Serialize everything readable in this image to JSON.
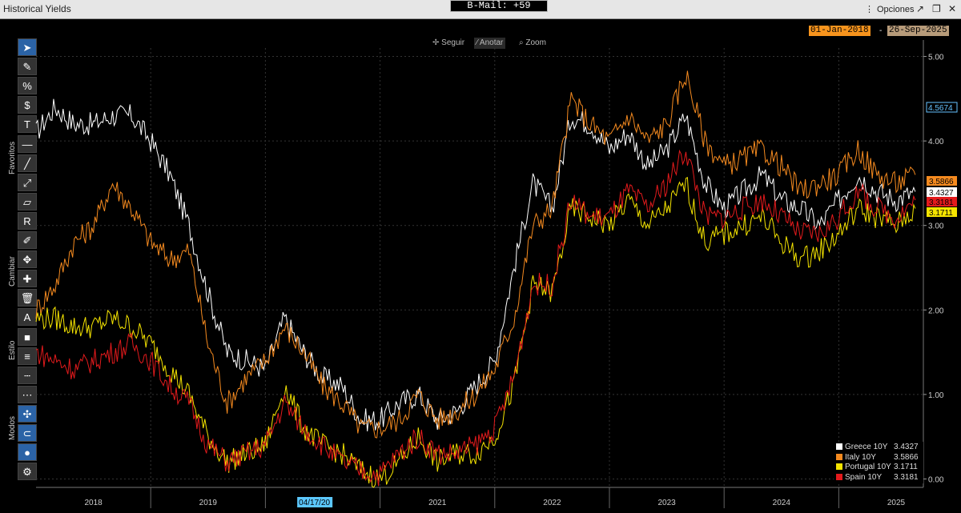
{
  "window": {
    "title": "Historical Yields",
    "bmail": "B-Mail: +59",
    "options_label": "Opciones"
  },
  "controls": {
    "follow": "Seguir",
    "annotate": "Anotar",
    "zoom": "Zoom",
    "start_date": "01-Jan-2018",
    "end_date": "26-Sep-2025",
    "start_color": "#f7941d",
    "end_color": "#b79b7a"
  },
  "toolbar": {
    "sections": [
      "Favoritos",
      "Cambiar",
      "Estilo",
      "Modos"
    ],
    "tools": [
      "cursor-icon",
      "pencil-icon",
      "percent-icon",
      "dollar-icon",
      "text-icon",
      "horizontal-line-icon",
      "trend-line-icon",
      "ray-line-icon",
      "channel-icon",
      "r-icon",
      "brush-icon",
      "move-icon",
      "add-point-icon",
      "trash-icon",
      "font-icon",
      "fill-icon",
      "line-weight-icon",
      "dashed-icon",
      "dotted-icon",
      "crosshair-icon",
      "magnet-icon",
      "colors-icon",
      "gear-icon"
    ]
  },
  "crosshair_date": "04/17/20",
  "chart_data": {
    "type": "line",
    "x": [
      "2018-01",
      "2018-03",
      "2018-05",
      "2018-07",
      "2018-09",
      "2018-11",
      "2019-01",
      "2019-03",
      "2019-05",
      "2019-07",
      "2019-09",
      "2019-11",
      "2020-01",
      "2020-03",
      "2020-05",
      "2020-07",
      "2020-09",
      "2020-11",
      "2021-01",
      "2021-03",
      "2021-05",
      "2021-07",
      "2021-09",
      "2021-11",
      "2022-01",
      "2022-03",
      "2022-05",
      "2022-07",
      "2022-09",
      "2022-11",
      "2023-01",
      "2023-03",
      "2023-05",
      "2023-07",
      "2023-09",
      "2023-11",
      "2024-01",
      "2024-03",
      "2024-05",
      "2024-07",
      "2024-09",
      "2024-11",
      "2025-01",
      "2025-03",
      "2025-05",
      "2025-07",
      "2025-09"
    ],
    "series": [
      {
        "name": "Greece 10Y",
        "color": "#ffffff",
        "last": "3.4327",
        "values": [
          4.1,
          4.4,
          4.2,
          4.2,
          4.3,
          4.3,
          4.0,
          3.6,
          3.0,
          2.2,
          1.5,
          1.4,
          1.3,
          1.9,
          1.5,
          1.2,
          1.1,
          0.7,
          0.7,
          0.9,
          1.0,
          0.7,
          0.8,
          1.1,
          1.4,
          2.5,
          3.5,
          3.2,
          4.3,
          4.2,
          3.9,
          4.1,
          3.7,
          3.9,
          4.3,
          3.5,
          3.2,
          3.4,
          3.6,
          3.3,
          3.2,
          3.0,
          3.3,
          3.6,
          3.4,
          3.3,
          3.4
        ]
      },
      {
        "name": "Italy 10Y",
        "color": "#f58a1f",
        "last": "3.5866",
        "values": [
          2.0,
          2.3,
          2.8,
          3.0,
          3.5,
          3.2,
          2.8,
          2.6,
          2.7,
          1.6,
          0.9,
          1.2,
          1.4,
          1.8,
          1.5,
          1.1,
          0.9,
          0.6,
          0.6,
          0.7,
          1.0,
          0.7,
          0.8,
          1.0,
          1.3,
          1.9,
          3.0,
          3.2,
          4.5,
          4.2,
          4.0,
          4.3,
          4.0,
          4.2,
          4.8,
          4.0,
          3.7,
          3.8,
          3.9,
          3.7,
          3.4,
          3.5,
          3.6,
          3.9,
          3.6,
          3.5,
          3.6
        ]
      },
      {
        "name": "Portugal 10Y",
        "color": "#f5e400",
        "last": "3.1711",
        "values": [
          1.9,
          1.9,
          1.8,
          1.8,
          1.9,
          1.8,
          1.6,
          1.3,
          1.0,
          0.5,
          0.2,
          0.3,
          0.4,
          1.1,
          0.6,
          0.4,
          0.3,
          0.1,
          0.0,
          0.2,
          0.5,
          0.2,
          0.3,
          0.3,
          0.5,
          1.1,
          2.3,
          2.2,
          3.2,
          3.1,
          3.0,
          3.3,
          3.0,
          3.2,
          3.5,
          2.8,
          2.9,
          3.0,
          3.1,
          2.8,
          2.6,
          2.7,
          2.9,
          3.2,
          3.1,
          3.0,
          3.2
        ]
      },
      {
        "name": "Spain 10Y",
        "color": "#e31a1c",
        "last": "3.3181",
        "values": [
          1.5,
          1.4,
          1.3,
          1.4,
          1.5,
          1.6,
          1.4,
          1.1,
          0.9,
          0.4,
          0.2,
          0.3,
          0.4,
          0.9,
          0.6,
          0.4,
          0.2,
          0.1,
          0.05,
          0.3,
          0.5,
          0.3,
          0.3,
          0.4,
          0.6,
          1.2,
          2.3,
          2.3,
          3.3,
          3.1,
          3.1,
          3.4,
          3.2,
          3.5,
          3.9,
          3.1,
          3.1,
          3.2,
          3.3,
          3.1,
          2.9,
          2.9,
          3.1,
          3.4,
          3.2,
          3.1,
          3.3
        ]
      }
    ],
    "y_ticks": [
      "0.00",
      "1.00",
      "2.00",
      "3.00",
      "4.00",
      "5.00"
    ],
    "ylim": [
      -0.1,
      5.1
    ],
    "x_ticks": [
      "2018",
      "2019",
      "2020",
      "2021",
      "2022",
      "2023",
      "2024",
      "2025"
    ],
    "extra_label": "4.5674",
    "legend_placement": "bottom-right"
  }
}
